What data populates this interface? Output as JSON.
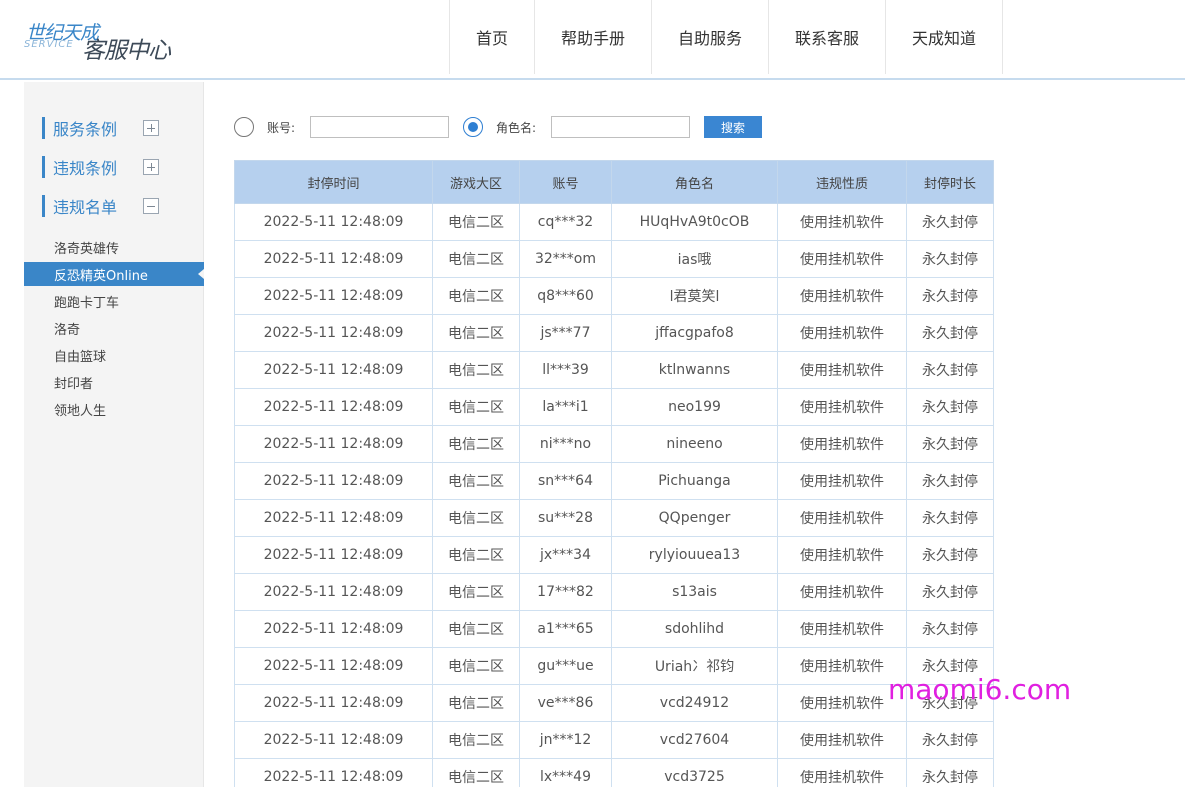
{
  "logo": {
    "line1": "世纪天成",
    "line2": "SERVICE",
    "line3": "客服中心"
  },
  "nav": [
    "首页",
    "帮助手册",
    "自助服务",
    "联系客服",
    "天成知道"
  ],
  "sidebar": {
    "sections": [
      {
        "label": "服务条例",
        "toggle": "plus"
      },
      {
        "label": "违规条例",
        "toggle": "plus"
      },
      {
        "label": "违规名单",
        "toggle": "minus"
      }
    ],
    "games": [
      "洛奇英雄传",
      "反恐精英Online",
      "跑跑卡丁车",
      "洛奇",
      "自由篮球",
      "封印者",
      "领地人生"
    ],
    "active_game": "反恐精英Online"
  },
  "search": {
    "account_label": "账号:",
    "role_label": "角色名:",
    "selected": "role",
    "account_value": "",
    "role_value": "",
    "button_label": "搜索"
  },
  "table": {
    "headers": [
      "封停时间",
      "游戏大区",
      "账号",
      "角色名",
      "违规性质",
      "封停时长"
    ],
    "rows": [
      [
        "2022-5-11 12:48:09",
        "电信二区",
        "cq***32",
        "HUqHvA9t0cOB",
        "使用挂机软件",
        "永久封停"
      ],
      [
        "2022-5-11 12:48:09",
        "电信二区",
        "32***om",
        "ias哦",
        "使用挂机软件",
        "永久封停"
      ],
      [
        "2022-5-11 12:48:09",
        "电信二区",
        "q8***60",
        "l君莫笑l",
        "使用挂机软件",
        "永久封停"
      ],
      [
        "2022-5-11 12:48:09",
        "电信二区",
        "js***77",
        "jffacgpafo8",
        "使用挂机软件",
        "永久封停"
      ],
      [
        "2022-5-11 12:48:09",
        "电信二区",
        "ll***39",
        "ktlnwanns",
        "使用挂机软件",
        "永久封停"
      ],
      [
        "2022-5-11 12:48:09",
        "电信二区",
        "la***i1",
        "neo199",
        "使用挂机软件",
        "永久封停"
      ],
      [
        "2022-5-11 12:48:09",
        "电信二区",
        "ni***no",
        "nineeno",
        "使用挂机软件",
        "永久封停"
      ],
      [
        "2022-5-11 12:48:09",
        "电信二区",
        "sn***64",
        "Pichuanga",
        "使用挂机软件",
        "永久封停"
      ],
      [
        "2022-5-11 12:48:09",
        "电信二区",
        "su***28",
        "QQpenger",
        "使用挂机软件",
        "永久封停"
      ],
      [
        "2022-5-11 12:48:09",
        "电信二区",
        "jx***34",
        "rylyiouuea13",
        "使用挂机软件",
        "永久封停"
      ],
      [
        "2022-5-11 12:48:09",
        "电信二区",
        "17***82",
        "s13ais",
        "使用挂机软件",
        "永久封停"
      ],
      [
        "2022-5-11 12:48:09",
        "电信二区",
        "a1***65",
        "sdohlihd",
        "使用挂机软件",
        "永久封停"
      ],
      [
        "2022-5-11 12:48:09",
        "电信二区",
        "gu***ue",
        "Uriah冫祁钧",
        "使用挂机软件",
        "永久封停"
      ],
      [
        "2022-5-11 12:48:09",
        "电信二区",
        "ve***86",
        "vcd24912",
        "使用挂机软件",
        "永久封停"
      ],
      [
        "2022-5-11 12:48:09",
        "电信二区",
        "jn***12",
        "vcd27604",
        "使用挂机软件",
        "永久封停"
      ],
      [
        "2022-5-11 12:48:09",
        "电信二区",
        "lx***49",
        "vcd3725",
        "使用挂机软件",
        "永久封停"
      ]
    ]
  },
  "watermark": "maomi6.com",
  "colors": {
    "accent": "#3a86c8",
    "table_header": "#b6d0ee",
    "watermark": "#e020e0"
  }
}
